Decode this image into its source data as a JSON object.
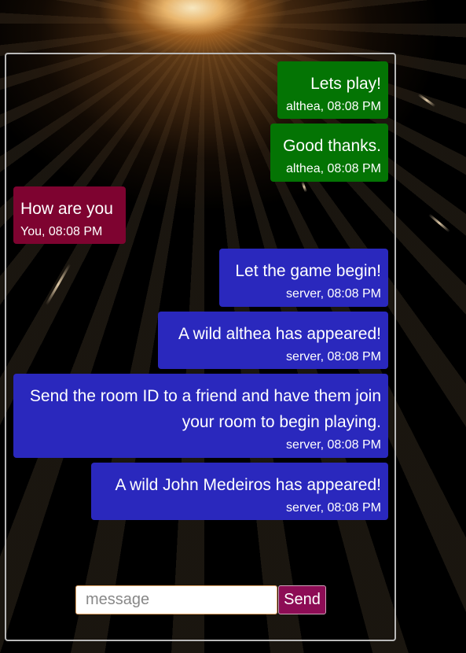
{
  "colors": {
    "own_message": "#047404",
    "user_message": "#7e0330",
    "server_message": "#2a28bd",
    "send_button": "#8d0c55"
  },
  "messages": [
    {
      "text": "Lets play!",
      "meta": "althea, 08:08 PM"
    },
    {
      "text": "Good thanks.",
      "meta": "althea, 08:08 PM"
    },
    {
      "text": "How are you",
      "meta": "You, 08:08 PM"
    },
    {
      "text": "Let the game begin!",
      "meta": "server, 08:08 PM"
    },
    {
      "text": "A wild althea has appeared!",
      "meta": "server, 08:08 PM"
    },
    {
      "text": "Send the room ID to a friend and have them join your room to begin playing.",
      "meta": "server, 08:08 PM"
    },
    {
      "text": "A wild John Medeiros has appeared!",
      "meta": "server, 08:08 PM"
    }
  ],
  "composer": {
    "placeholder": "message",
    "value": "",
    "send_label": "Send"
  }
}
